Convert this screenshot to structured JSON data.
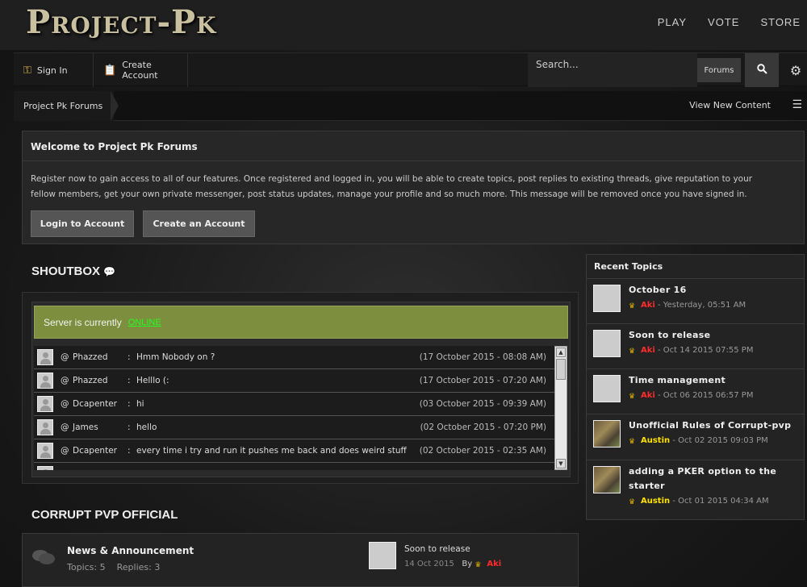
{
  "header": {
    "logo": "Project-Pk",
    "nav": [
      "PLAY",
      "VOTE",
      "STORE"
    ]
  },
  "userbar": {
    "sign_in": "Sign In",
    "create_account": "Create Account",
    "search_placeholder": "Search...",
    "search_scope": "Forums"
  },
  "breadcrumb": {
    "home": "Project Pk Forums",
    "view_new": "View New Content"
  },
  "welcome": {
    "title": "Welcome to Project Pk Forums",
    "text": "Register now to gain access to all of our features. Once registered and logged in, you will be able to create topics, post replies to existing threads, give reputation to your fellow members, get your own private messenger, post status updates, manage your profile and so much more. This message will be removed once you have signed in.",
    "login_btn": "Login to Account",
    "create_btn": "Create an Account"
  },
  "shoutbox": {
    "title": "SHOUTBOX",
    "status_text": "Server is currently",
    "status_value": "ONLINE",
    "messages": [
      {
        "at": "@",
        "user": "Phazzed",
        "text": "Hmm Nobody on ?",
        "time": "(17 October 2015 - 08:08 AM)"
      },
      {
        "at": "@",
        "user": "Phazzed",
        "text": "Helllo (:",
        "time": "(17 October 2015 - 07:20 AM)"
      },
      {
        "at": "@",
        "user": "Dcapenter",
        "text": "hi",
        "time": "(03 October 2015 - 09:39 AM)"
      },
      {
        "at": "@",
        "user": "James",
        "text": "hello",
        "time": "(02 October 2015 - 07:20 PM)"
      },
      {
        "at": "@",
        "user": "Dcapenter",
        "text": "every time i try and run it pushes me back and does weird stuff",
        "time": "(02 October 2015 - 02:35 AM)"
      }
    ]
  },
  "category": {
    "title": "CORRUPT PVP OFFICIAL",
    "forum": {
      "name": "News & Announcement",
      "topics_label": "Topics:",
      "topics": "5",
      "replies_label": "Replies:",
      "replies": "3",
      "last_title": "Soon to release",
      "last_date": "14 Oct 2015",
      "last_by": "By",
      "last_user": "Aki"
    }
  },
  "recent": {
    "title": "Recent Topics",
    "items": [
      {
        "title": "October 16",
        "user": "Aki",
        "date": "- Yesterday, 05:51 AM"
      },
      {
        "title": "Soon to release",
        "user": "Aki",
        "date": "- Oct 14 2015 07:55 PM"
      },
      {
        "title": "Time management",
        "user": "Aki",
        "date": "- Oct 06 2015 06:57 PM"
      },
      {
        "title": "Unofficial Rules of Corrupt-pvp",
        "user": "Austin",
        "date": "- Oct 02 2015 09:03 PM"
      },
      {
        "title": "adding a PKER option to the starter",
        "user": "Austin",
        "date": "- Oct 01 2015 04:34 AM"
      }
    ]
  },
  "icons": {
    "crown": "crown-icon",
    "key": "key-icon",
    "clipboard": "clipboard-icon",
    "search": "search-icon",
    "gear": "gear-icon"
  },
  "colors": {
    "admin_user": "#ff2a2a",
    "member_user": "#ffe100",
    "online": "#22ff22",
    "status_bg": "#7d8e3e"
  }
}
